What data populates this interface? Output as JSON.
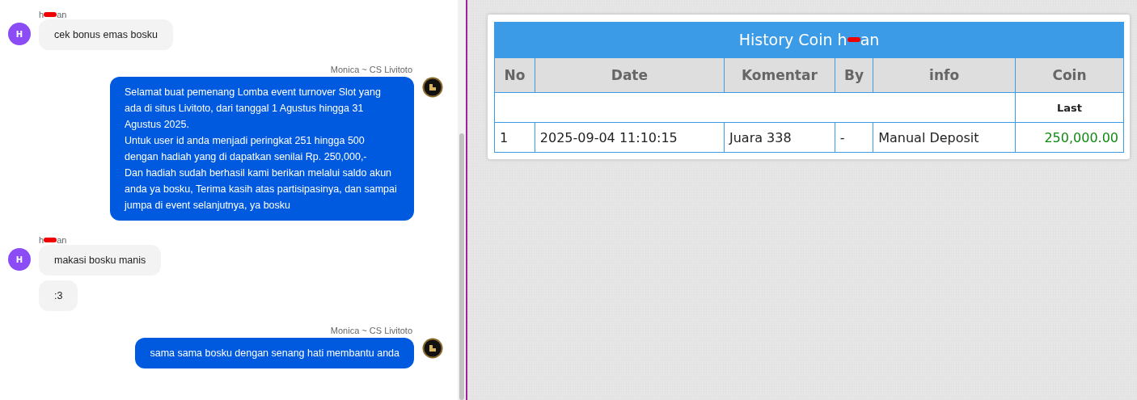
{
  "chat": {
    "messages": [
      {
        "kind": "user",
        "name_start": "h",
        "name_end": "an",
        "avatar": "H",
        "bubbles": [
          "cek bonus emas bosku"
        ]
      },
      {
        "kind": "agent",
        "name": "Monica ~ CS Livitoto",
        "bubbles": [
          "Selamat buat pemenang Lomba event turnover Slot yang ada di situs Livitoto, dari tanggal 1 Agustus hingga 31 Agustus 2025.\nUntuk user id anda menjadi peringkat 251 hingga 500 dengan hadiah yang di dapatkan senilai Rp. 250,000,-\nDan hadiah sudah berhasil kami berikan melalui saldo akun anda ya bosku, Terima kasih atas partisipasinya, dan sampai jumpa di event selanjutnya, ya bosku"
        ]
      },
      {
        "kind": "user",
        "name_start": "h",
        "name_end": "an",
        "avatar": "H",
        "bubbles": [
          "makasi bosku manis",
          ":3"
        ]
      },
      {
        "kind": "agent",
        "name": "Monica ~ CS Livitoto",
        "bubbles": [
          "sama sama bosku dengan senang hati membantu anda"
        ]
      }
    ]
  },
  "history": {
    "title_start": "History Coin h",
    "title_end": "an",
    "columns": [
      "No",
      "Date",
      "Komentar",
      "By",
      "info",
      "Coin"
    ],
    "subheader": "Last",
    "rows": [
      {
        "no": "1",
        "date": "2025-09-04 11:10:15",
        "komentar": "Juara 338",
        "by": "-",
        "info": "Manual Deposit",
        "coin": "250,000.00"
      }
    ]
  }
}
